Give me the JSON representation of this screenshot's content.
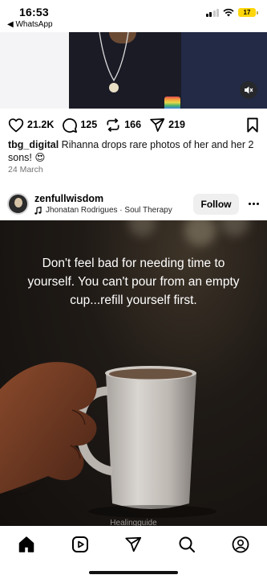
{
  "status_bar": {
    "time": "16:53",
    "back_label": "◀ WhatsApp",
    "battery": "17"
  },
  "post_1": {
    "likes": "21.2K",
    "comments": "125",
    "reposts": "166",
    "shares": "219",
    "caption_user": "tbg_digital",
    "caption_text": " Rihanna drops rare photos of her and her 2 sons! 😍",
    "date": "24 March"
  },
  "post_2": {
    "username": "zenfullwisdom",
    "music": "Jhonatan Rodrigues · Soul Therapy",
    "follow_label": "Follow",
    "quote": "Don't feel bad for needing time to yourself. You can't pour from an empty cup...refill yourself first.",
    "watermark": "Healingguide"
  },
  "icons": {
    "home": "home-icon",
    "reels": "reels-icon",
    "send": "send-icon",
    "search": "search-icon",
    "profile": "profile-icon"
  },
  "colors": {
    "text": "#000000",
    "muted": "#737373",
    "button_bg": "#efefef",
    "battery": "#ffd60a"
  }
}
